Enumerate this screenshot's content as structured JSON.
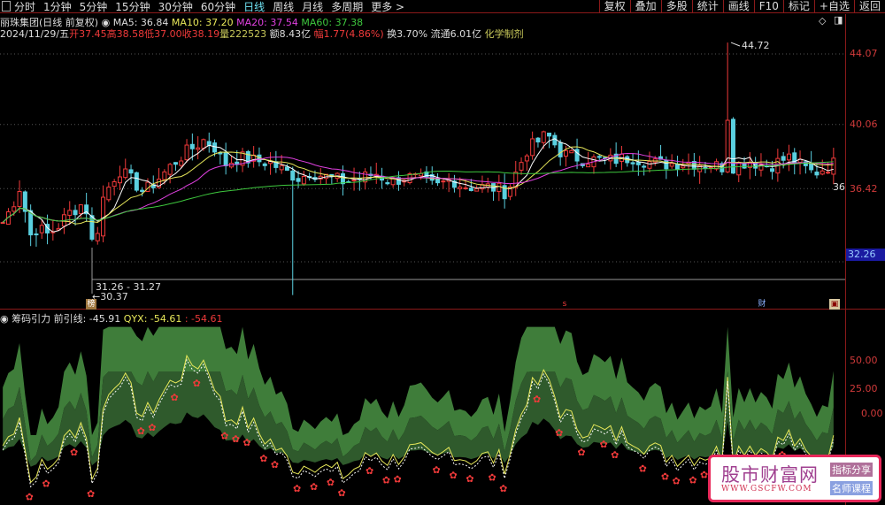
{
  "toolbar": {
    "periods": [
      "分时",
      "1分钟",
      "5分钟",
      "15分钟",
      "30分钟",
      "60分钟",
      "日线",
      "周线",
      "月线",
      "多周期",
      "更多 >"
    ],
    "active": "日线",
    "tools": [
      "复权",
      "叠加",
      "多股",
      "统计",
      "画线",
      "F10",
      "标记",
      "+自选",
      "返回"
    ]
  },
  "stock": {
    "title": "丽珠集团(日线 前复权)",
    "ma5": "MA5: 36.84",
    "ma10": "MA10: 37.20",
    "ma20": "MA20: 37.54",
    "ma60": "MA60: 37.38",
    "date": "2024/11/29/五",
    "open": "开37.45",
    "high": "高38.58",
    "low": "低37.00",
    "close": "收38.19",
    "volume": "量222523",
    "amount": "额8.43亿",
    "change": "幅1.77(4.86%)",
    "turnover": "换3.70%",
    "float": "流通6.01亿",
    "sector": "化学制剂"
  },
  "price_axis": [
    "44.07",
    "40.06",
    "36.42"
  ],
  "current_price": "32.26",
  "annotations": {
    "max": "44.72",
    "range": "31.26 - 31.27",
    "min": "←30.37",
    "last": "36",
    "tag_bang": "榜",
    "tag_cai": "财",
    "tag_s": "s"
  },
  "indicator": {
    "name": "筹码引力",
    "line1": "前引线: -45.91",
    "line2": "QYX: -54.61",
    "line3": ": -54.61",
    "axis": [
      "50.00",
      "25.00",
      "0.00"
    ]
  },
  "watermark": {
    "name": "股市财富网",
    "url": "WWW.GSCFW.COM",
    "badge1": "指标分享",
    "badge2": "名师课程"
  },
  "chart_data": {
    "type": "candlestick",
    "price_keyframes": [
      [
        0,
        34.5
      ],
      [
        10,
        35.5
      ],
      [
        16,
        36.6
      ],
      [
        22,
        35.2
      ],
      [
        28,
        33.7
      ],
      [
        34,
        34.2
      ],
      [
        45,
        33.8
      ],
      [
        55,
        34.3
      ],
      [
        65,
        35.0
      ],
      [
        80,
        35.6
      ],
      [
        86,
        34.8
      ],
      [
        90,
        32.6
      ],
      [
        95,
        34.5
      ],
      [
        100,
        36.0
      ],
      [
        115,
        37.5
      ],
      [
        130,
        36.8
      ],
      [
        140,
        36.2
      ],
      [
        160,
        37.3
      ],
      [
        170,
        37.9
      ],
      [
        180,
        38.4
      ],
      [
        200,
        39.2
      ],
      [
        210,
        38.8
      ],
      [
        220,
        37.8
      ],
      [
        235,
        38.2
      ],
      [
        250,
        38.0
      ],
      [
        265,
        37.9
      ],
      [
        280,
        37.4
      ],
      [
        295,
        37.0
      ],
      [
        305,
        37.4
      ],
      [
        320,
        37.1
      ],
      [
        340,
        36.8
      ],
      [
        355,
        37.0
      ],
      [
        370,
        37.3
      ],
      [
        385,
        36.8
      ],
      [
        400,
        37.1
      ],
      [
        415,
        36.9
      ],
      [
        430,
        36.5
      ],
      [
        445,
        37.0
      ],
      [
        455,
        36.6
      ],
      [
        470,
        36.5
      ],
      [
        485,
        36.5
      ],
      [
        500,
        36.2
      ],
      [
        520,
        38.6
      ],
      [
        540,
        39.5
      ],
      [
        555,
        38.4
      ],
      [
        575,
        38.1
      ],
      [
        600,
        38.0
      ],
      [
        625,
        38.2
      ],
      [
        650,
        37.8
      ],
      [
        680,
        37.9
      ],
      [
        700,
        37.8
      ],
      [
        720,
        37.6
      ],
      [
        740,
        38.0
      ],
      [
        760,
        37.7
      ],
      [
        780,
        38.2
      ],
      [
        795,
        37.6
      ],
      [
        805,
        37.3
      ],
      [
        830,
        38.0
      ]
    ],
    "ma_colors": {
      "ma5": "#ffffff",
      "ma10": "#e8e85a",
      "ma20": "#e040e0",
      "ma60": "#3ec83e"
    },
    "max": 44.72,
    "min": 30.37
  }
}
